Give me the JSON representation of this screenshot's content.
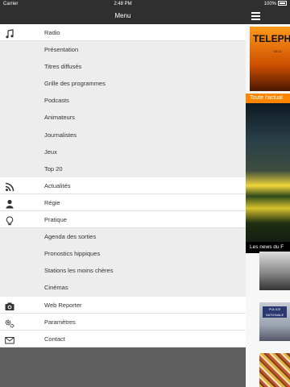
{
  "status_bar": {
    "carrier": "Carrier",
    "time": "2:48 PM",
    "battery": "100%"
  },
  "menu": {
    "title": "Menu",
    "items": [
      {
        "label": "Radio",
        "icon": "music-note-icon",
        "type": "section"
      },
      {
        "label": "Présentation",
        "type": "sub"
      },
      {
        "label": "Titres diffusés",
        "type": "sub"
      },
      {
        "label": "Grille des programmes",
        "type": "sub"
      },
      {
        "label": "Podcasts",
        "type": "sub"
      },
      {
        "label": "Animateurs",
        "type": "sub"
      },
      {
        "label": "Journalistes",
        "type": "sub"
      },
      {
        "label": "Jeux",
        "type": "sub"
      },
      {
        "label": "Top 20",
        "type": "sub"
      },
      {
        "label": "Actualités",
        "icon": "rss-icon",
        "type": "section"
      },
      {
        "label": "Régie",
        "icon": "person-icon",
        "type": "section"
      },
      {
        "label": "Pratique",
        "icon": "lightbulb-icon",
        "type": "section"
      },
      {
        "label": "Agenda des sorties",
        "type": "sub"
      },
      {
        "label": "Pronostics hippiques",
        "type": "sub"
      },
      {
        "label": "Stations les moins chères",
        "type": "sub"
      },
      {
        "label": "Cinémas",
        "type": "sub"
      },
      {
        "label": "Web Reporter",
        "icon": "camera-icon",
        "type": "section"
      },
      {
        "label": "Paramètres",
        "icon": "gears-icon",
        "type": "section"
      },
      {
        "label": "Contact",
        "icon": "envelope-icon",
        "type": "section"
      }
    ]
  },
  "content": {
    "banner_text": "TELEPH",
    "banner_subtext": "LE LI",
    "section_label": "Toute l'actual",
    "photo_caption": "Les news du F",
    "tile_text": "POLICE NATIONALE"
  }
}
